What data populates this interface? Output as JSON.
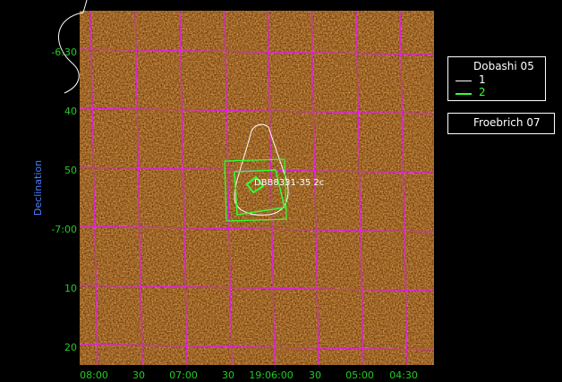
{
  "chart_data": {
    "type": "image",
    "ylabel": "Declination",
    "x_ticks": [
      "08:00",
      "30",
      "07:00",
      "30",
      "19:06:00",
      "30",
      "05:00",
      "04:30"
    ],
    "y_ticks": [
      "-6:30",
      "40",
      "50",
      "-7:00",
      "10",
      "20"
    ],
    "source_label": "DBB8331-35 2c",
    "colors": {
      "background": "#000000",
      "image_dust": "#8a4a10",
      "grid": "#e020e0",
      "tick_text": "#22cc22",
      "axis_title": "#4a7fff",
      "contour_1": "#ffffff",
      "contour_2": "#33ff33"
    }
  },
  "legends": [
    {
      "title": "Dobashi 05",
      "entries": [
        {
          "label": "1",
          "color": "#ffffff"
        },
        {
          "label": "2",
          "color": "#33ff33"
        }
      ]
    },
    {
      "title": "Froebrich 07"
    }
  ]
}
